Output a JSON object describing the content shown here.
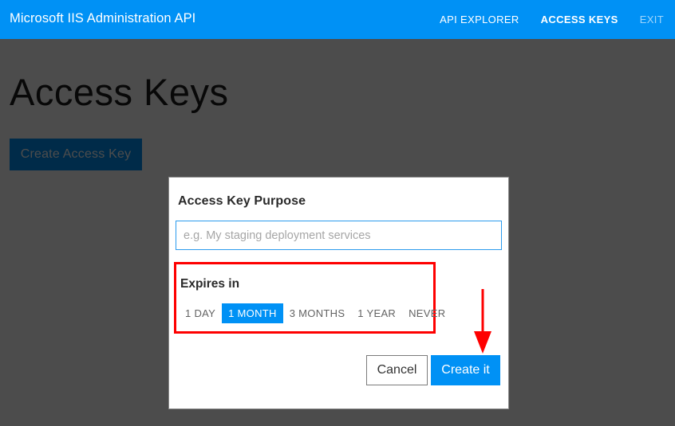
{
  "header": {
    "brand": "Microsoft IIS Administration API",
    "nav": [
      {
        "label": "API EXPLORER",
        "state": "normal"
      },
      {
        "label": "ACCESS KEYS",
        "state": "active"
      },
      {
        "label": "EXIT",
        "state": "dim"
      }
    ],
    "background_color": "#0091f5",
    "text_color": "#ffffff"
  },
  "page": {
    "title": "Access Keys",
    "create_button_label": "Create Access Key",
    "create_button_color": "#0091f5",
    "overlay_color": "#4d4d4d"
  },
  "modal": {
    "purpose_label": "Access Key Purpose",
    "purpose_placeholder": "e.g. My staging deployment services",
    "purpose_value": "",
    "input_border_color": "#2b9bee",
    "expires": {
      "label": "Expires in",
      "options": [
        {
          "label": "1 DAY",
          "selected": false
        },
        {
          "label": "1 MONTH",
          "selected": true
        },
        {
          "label": "3 MONTHS",
          "selected": false
        },
        {
          "label": "1 YEAR",
          "selected": false
        },
        {
          "label": "NEVER",
          "selected": false
        }
      ],
      "selected": "1 MONTH",
      "highlight_color": "#fe0000",
      "selected_color": "#0091f5"
    },
    "cancel_label": "Cancel",
    "submit_label": "Create it",
    "submit_color": "#0091f5"
  },
  "annotations": {
    "arrow_color": "#fe0000",
    "arrow_direction": "down",
    "arrow_target": "Create it"
  }
}
